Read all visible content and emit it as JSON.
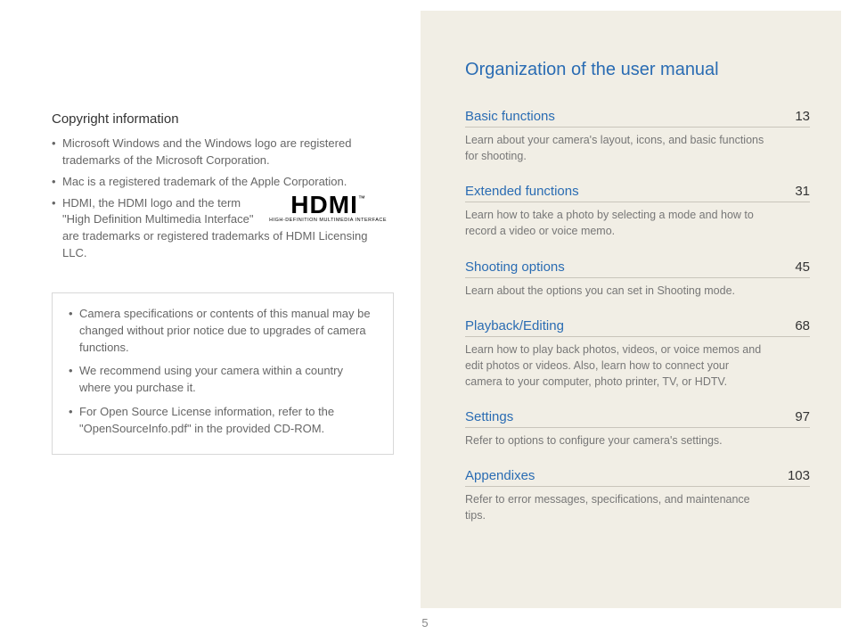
{
  "page_number": "5",
  "left": {
    "heading": "Copyright information",
    "bullets": [
      "Microsoft Windows and the Windows logo are registered trademarks of the Microsoft Corporation.",
      "Mac is a registered trademark of the Apple Corporation.",
      "HDMI, the HDMI logo and the term \"High Definition Multimedia Interface\" are trademarks or registered trademarks of HDMI Licensing LLC."
    ],
    "hdmi": {
      "logo": "HDMI",
      "tm": "™",
      "sub": "HIGH-DEFINITION MULTIMEDIA INTERFACE"
    },
    "note_bullets": [
      "Camera specifications or contents of this manual may be changed without prior notice due to upgrades of camera functions.",
      "We recommend using your camera within a country where you purchase it.",
      "For Open Source License information, refer to the \"OpenSourceInfo.pdf\" in the provided CD-ROM."
    ]
  },
  "right": {
    "title": "Organization of the user manual",
    "entries": [
      {
        "label": "Basic functions",
        "page": "13",
        "desc": "Learn about your camera's layout, icons, and basic functions for shooting."
      },
      {
        "label": "Extended functions",
        "page": "31",
        "desc": "Learn how to take a photo by selecting a mode and how to record a video or voice memo."
      },
      {
        "label": "Shooting options",
        "page": "45",
        "desc": "Learn about the options you can set in Shooting mode."
      },
      {
        "label": "Playback/Editing",
        "page": "68",
        "desc": "Learn how to play back photos, videos, or voice memos and edit photos or videos. Also, learn how to connect your camera to your computer, photo printer, TV, or HDTV."
      },
      {
        "label": "Settings",
        "page": "97",
        "desc": "Refer to options to configure your camera's settings."
      },
      {
        "label": "Appendixes",
        "page": "103",
        "desc": "Refer to error messages, specifications, and maintenance tips."
      }
    ]
  }
}
